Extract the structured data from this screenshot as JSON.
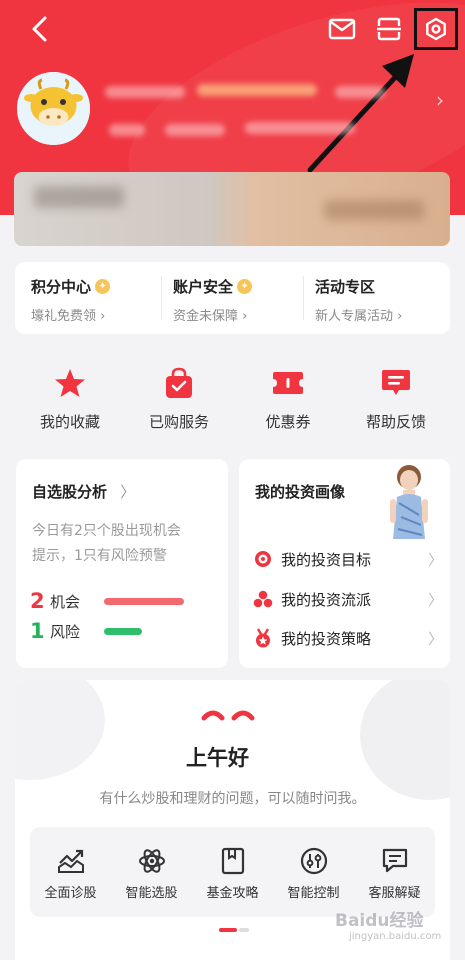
{
  "header": {
    "back_icon": "back-arrow-icon",
    "mail_icon": "mail-icon",
    "scan_icon": "scan-icon",
    "settings_icon": "settings-gear-icon",
    "brand_color": "#f03540"
  },
  "profile": {
    "avatar_icon": "cow-avatar",
    "chevron": "›"
  },
  "points_bar": [
    {
      "title": "积分中心",
      "subtitle": "壕礼免费领 ›"
    },
    {
      "title": "账户安全",
      "subtitle": "资金未保障 ›"
    },
    {
      "title": "活动专区",
      "subtitle": "新人专属活动 ›"
    }
  ],
  "quick_actions": [
    {
      "label": "我的收藏",
      "icon": "star-icon"
    },
    {
      "label": "已购服务",
      "icon": "shopping-bag-icon"
    },
    {
      "label": "优惠券",
      "icon": "coupon-icon"
    },
    {
      "label": "帮助反馈",
      "icon": "feedback-icon"
    }
  ],
  "stock_analysis": {
    "title": "自选股分析",
    "chevron": "〉",
    "desc_line1": "今日有2只个股出现机会",
    "desc_line2": "提示，1只有风险预警",
    "opportunity_count": "2",
    "opportunity_label": "机会",
    "risk_count": "1",
    "risk_label": "风险",
    "opportunity_color": "#f0545c",
    "risk_color": "#2fbf6b"
  },
  "investment_profile": {
    "title": "我的投资画像",
    "items": [
      {
        "label": "我的投资目标",
        "icon": "target-icon",
        "chevron": "〉"
      },
      {
        "label": "我的投资流派",
        "icon": "school-icon",
        "chevron": "〉"
      },
      {
        "label": "我的投资策略",
        "icon": "strategy-icon",
        "chevron": "〉"
      }
    ]
  },
  "assistant": {
    "greeting": "上午好",
    "subtitle": "有什么炒股和理财的问题，可以随时问我。",
    "tools": [
      {
        "label": "全面诊股",
        "icon": "chart-diagnosis-icon"
      },
      {
        "label": "智能选股",
        "icon": "atom-icon"
      },
      {
        "label": "基金攻略",
        "icon": "book-icon"
      },
      {
        "label": "智能控制",
        "icon": "control-dial-icon"
      },
      {
        "label": "客服解疑",
        "icon": "chat-icon"
      }
    ]
  },
  "watermark": {
    "line1": "Baidu经验",
    "line2": "jingyan.baidu.com"
  }
}
